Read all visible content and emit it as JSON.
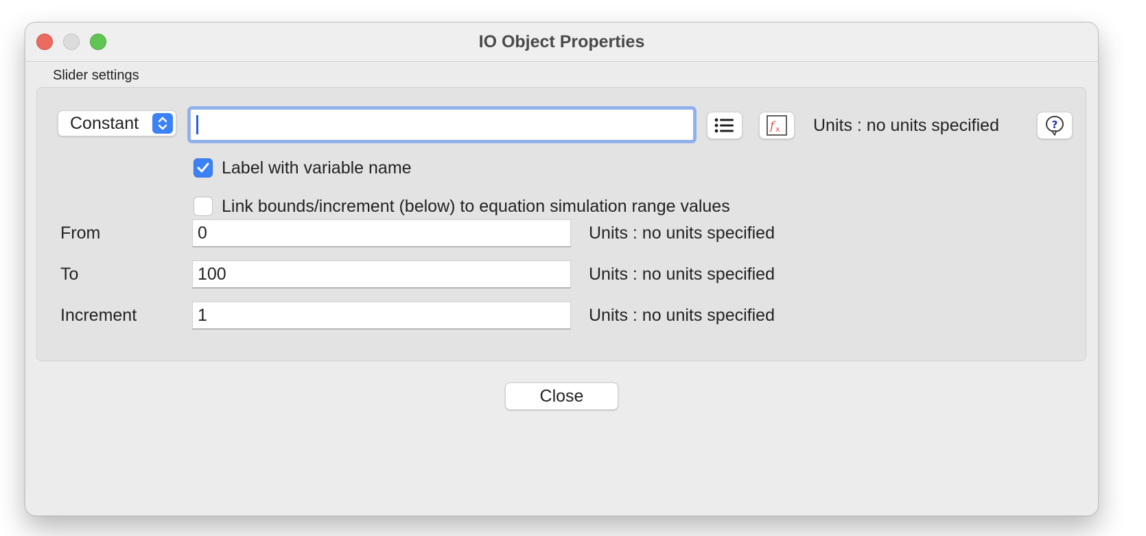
{
  "window": {
    "title": "IO Object Properties"
  },
  "group": {
    "label": "Slider settings"
  },
  "type_popup": {
    "selected": "Constant",
    "icon": "up-down-chevron-icon"
  },
  "variable_field": {
    "value": "",
    "placeholder": ""
  },
  "toolbar": {
    "list_icon": "list-icon",
    "function_icon": "fx-icon",
    "help_icon": "help-icon",
    "units": "Units : no units specified"
  },
  "options": {
    "label_with_name": {
      "label": "Label with variable name",
      "checked": true
    },
    "link_bounds": {
      "label": "Link bounds/increment (below) to equation simulation range values",
      "checked": false
    }
  },
  "rows": [
    {
      "label": "From",
      "value": "0",
      "units": "Units : no units specified"
    },
    {
      "label": "To",
      "value": "100",
      "units": "Units : no units specified"
    },
    {
      "label": "Increment",
      "value": "1",
      "units": "Units : no units specified"
    }
  ],
  "actions": {
    "close_label": "Close"
  },
  "colors": {
    "accent": "#3b82f6",
    "close_light": "#ed6a5e",
    "zoom_light": "#61c554",
    "fx_red": "#e0504a"
  }
}
